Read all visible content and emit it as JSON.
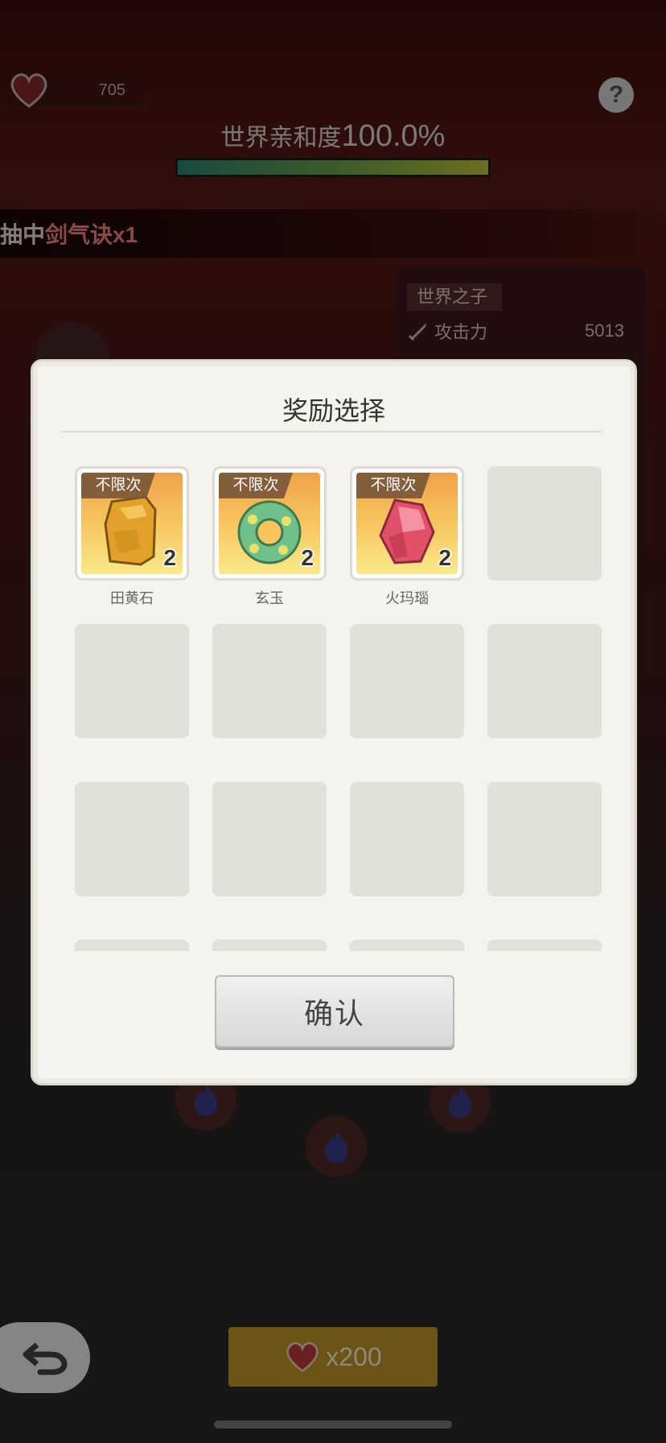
{
  "hud": {
    "hearts": "705",
    "help": "?",
    "affinity_label": "世界亲和度",
    "affinity_value": "100.0%",
    "affinity_progress": 1.0
  },
  "ticker": {
    "prefix": "抽中",
    "highlight": "剑气诀x1"
  },
  "character_panel": {
    "title": "世界之子",
    "stat_label": "攻击力",
    "stat_value": "5013"
  },
  "bottom": {
    "cost": "x200"
  },
  "modal": {
    "title": "奖励选择",
    "confirm": "确认",
    "items": [
      {
        "name": "田黄石",
        "tag": "不限次",
        "qty": "2",
        "icon": "yellow-stone-icon"
      },
      {
        "name": "玄玉",
        "tag": "不限次",
        "qty": "2",
        "icon": "jade-ring-icon"
      },
      {
        "name": "火玛瑙",
        "tag": "不限次",
        "qty": "2",
        "icon": "red-agate-icon"
      }
    ]
  },
  "colors": {
    "accent_red": "#f28787",
    "gold_button": "#c49a28",
    "modal_bg": "#f4f3ed"
  }
}
